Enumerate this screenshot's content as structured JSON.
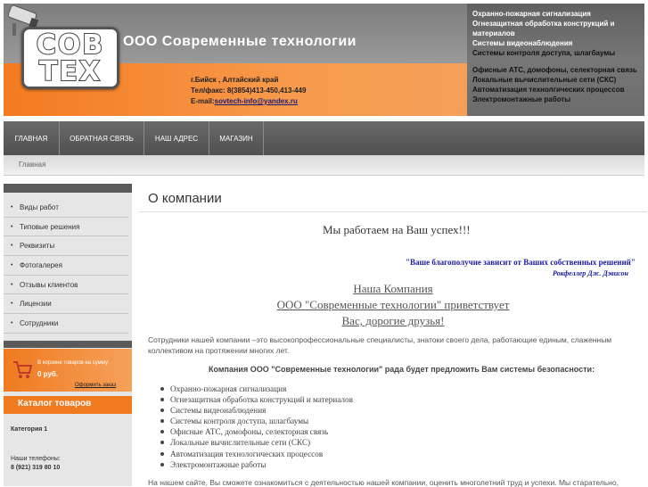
{
  "header": {
    "logo_line1": "СОВ",
    "logo_line2": "ТЕХ",
    "company_name": "ООО Современные технологии",
    "city": "г.Бийск , Алтайский край",
    "phone_fax": "Тел/факс: 8(3854)413-450,413-449",
    "email_label": "E-mail:",
    "email": "sovtech-info@yandex.ru",
    "services_top": [
      "Охранно-пожарная сигнализация",
      "Огнезащитная обработка конструкций и материалов",
      "Системы видеонаблюдения",
      "Системы контроля доступа, шлагбаумы"
    ],
    "services_bottom": [
      "Офисные АТС, домофоны, селекторная связь",
      "Локальные вычислительные сети  (СКС)",
      "Автоматизация технолгических процессов",
      "Электромонтажные работы"
    ]
  },
  "nav": {
    "items": [
      "ГЛАВНАЯ",
      "ОБРАТНАЯ СВЯЗЬ",
      "НАШ АДРЕС",
      "МАГАЗИН"
    ]
  },
  "breadcrumb": "Главная",
  "sidebar": {
    "items": [
      "Виды работ",
      "Типовые решения",
      "Реквизиты",
      "Фотогалерея",
      "Отзывы клиентов",
      "Лицензии",
      "Сотрудники"
    ],
    "cart_text": "В корзине товаров на сумму:",
    "cart_total": "0 руб.",
    "cart_checkout": "Оформить заказ",
    "catalog_title": "Каталог товаров",
    "category": "Категория 1",
    "phones_label": "Наши телефоны:",
    "phone": "8 (921) 319 80 10"
  },
  "main": {
    "title": "О компании",
    "slogan": "Мы работаем на Ваш успех!!!",
    "quote": "\"Ваше благополучие зависит от Ваших собственных решений\"",
    "quote_author": "Рокфеллер Дж. Дэвисон",
    "greeting": [
      "Наша Компания",
      "ООО \"Современные технологии\" приветствует",
      "Вас, дорогие друзья!"
    ],
    "paragraph": "Сотрудники нашей компании –это высокопрофессиональные специалисты, знатоки своего дела, работающие единым, слаженным коллективом на протяжении многих лет.",
    "offer": "Компания ООО \"Современные технологии\" рада будет предложить Вам системы безопасности:",
    "services": [
      "Охранно-пожарная сигнализация",
      "Огнезащитная обработка конструкций и материалов",
      "Системы видеонаблюдения",
      "Системы контроля доступа, шлагбаумы",
      "Офисные АТС, домофоны, селекторная связь",
      "Локальные вычислительные сети  (СКС)",
      "Автоматизация технологических процессов",
      "Электромонтажные работы"
    ],
    "bottom_text": "На нашем сайте, Вы сможете ознакомиться с деятельностью нашей компании, оценить многолетний труд и успехи. Мы старательно,"
  }
}
